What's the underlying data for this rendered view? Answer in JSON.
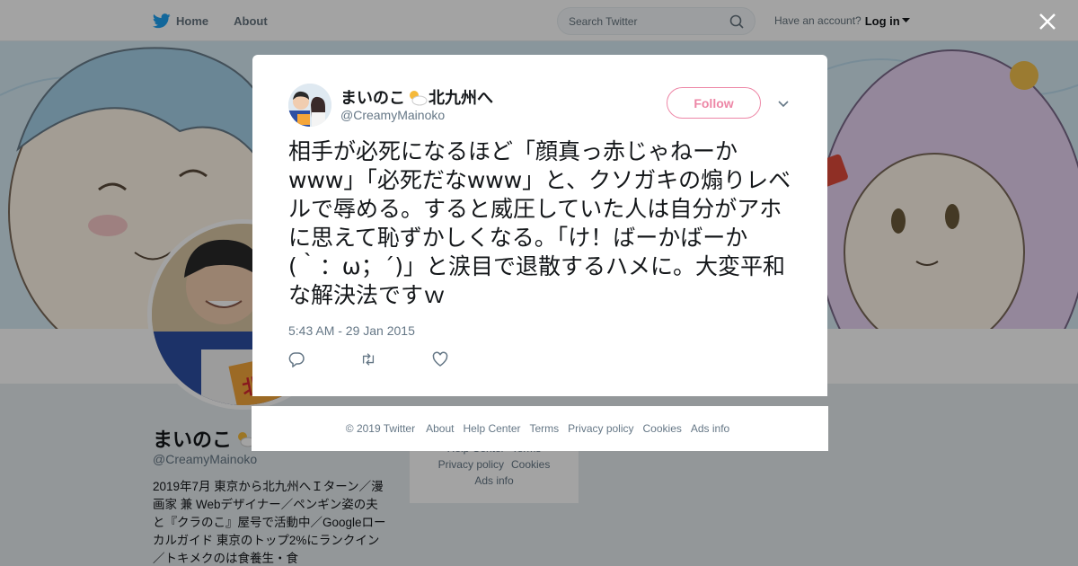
{
  "topbar": {
    "home_label": "Home",
    "about_label": "About",
    "search_placeholder": "Search Twitter",
    "account_prompt": "Have an account?",
    "login_label": "Log in"
  },
  "profile": {
    "name": "まいのこ",
    "handle": "@CreamyMainoko",
    "bio": "2019年7月 東京から北九州へＩターン／漫画家 兼 Webデザイナー／ペンギン姿の夫と『クラのこ』屋号で活動中／Googleローカルガイド 東京のトップ2%にランクイン／トキメクのは食養生・食"
  },
  "side_footer": {
    "links": [
      "Help Center",
      "Terms",
      "Privacy policy",
      "Cookies",
      "Ads info"
    ]
  },
  "tweet": {
    "display_name": "まいのこ",
    "name_suffix": "北九州へ",
    "handle": "@CreamyMainoko",
    "follow_label": "Follow",
    "text": "相手が必死になるほど「顔真っ赤じゃねーかwww」「必死だなwww」と、クソガキの煽りレベルで辱める。すると威圧していた人は自分がアホに思えて恥ずかしくなる。「け！ばーかばーか(｀：ω；´)」と涙目で退散するハメに。大変平和な解決法ですｗ",
    "timestamp": "5:43 AM - 29 Jan 2015"
  },
  "modal_footer": {
    "copyright": "© 2019 Twitter",
    "links": [
      "About",
      "Help Center",
      "Terms",
      "Privacy policy",
      "Cookies",
      "Ads info"
    ]
  },
  "colors": {
    "accent": "#1da1f2",
    "follow": "#e0245e",
    "secondary_text": "#657786"
  },
  "icons": [
    "twitter-bird-icon",
    "search-icon",
    "caret-down-icon",
    "close-icon",
    "sun-cloud-emoji-icon",
    "reply-icon",
    "retweet-icon",
    "like-icon"
  ]
}
